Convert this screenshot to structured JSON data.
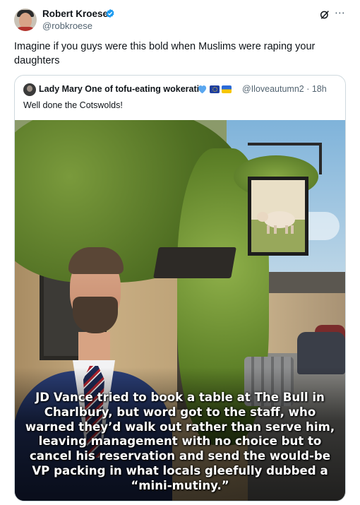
{
  "author": {
    "name": "Robert Kroese",
    "handle": "@robkroese",
    "verified_color": "#1d9bf0"
  },
  "post": {
    "text": "Imagine if you guys were this bold when Muslims were raping your daughters"
  },
  "icons": [
    "verified-badge-icon",
    "grok-icon",
    "more-icon"
  ],
  "quoted": {
    "name": "Lady Mary One of tofu-eating wokerati",
    "badges": [
      "blue-heart-icon",
      "eu-flag-icon",
      "ukraine-flag-icon"
    ],
    "handle_time": "@Iloveautumn2 · 18h",
    "text": "Well done the Cotswolds!",
    "media_caption": "JD Vance tried to book a table at The Bull in Charlbury, but word got to the staff, who warned they’d walk out rather than serve him, leaving management with no choice but to cancel his reservation and send the would-be VP packing in what locals gleefully dubbed a “mini-mutiny.”"
  }
}
